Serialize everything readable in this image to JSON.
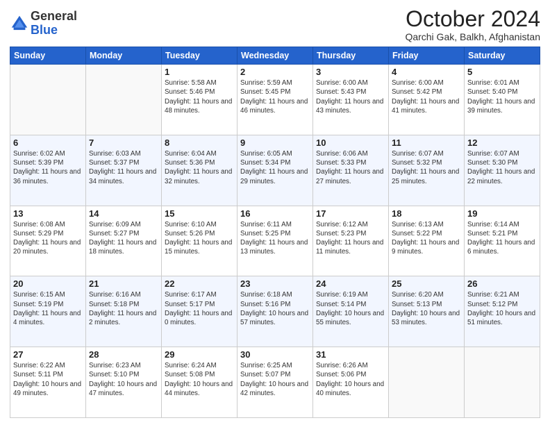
{
  "header": {
    "logo_line1": "General",
    "logo_line2": "Blue",
    "month": "October 2024",
    "location": "Qarchi Gak, Balkh, Afghanistan"
  },
  "weekdays": [
    "Sunday",
    "Monday",
    "Tuesday",
    "Wednesday",
    "Thursday",
    "Friday",
    "Saturday"
  ],
  "weeks": [
    [
      {
        "day": "",
        "detail": ""
      },
      {
        "day": "",
        "detail": ""
      },
      {
        "day": "1",
        "detail": "Sunrise: 5:58 AM\nSunset: 5:46 PM\nDaylight: 11 hours and 48 minutes."
      },
      {
        "day": "2",
        "detail": "Sunrise: 5:59 AM\nSunset: 5:45 PM\nDaylight: 11 hours and 46 minutes."
      },
      {
        "day": "3",
        "detail": "Sunrise: 6:00 AM\nSunset: 5:43 PM\nDaylight: 11 hours and 43 minutes."
      },
      {
        "day": "4",
        "detail": "Sunrise: 6:00 AM\nSunset: 5:42 PM\nDaylight: 11 hours and 41 minutes."
      },
      {
        "day": "5",
        "detail": "Sunrise: 6:01 AM\nSunset: 5:40 PM\nDaylight: 11 hours and 39 minutes."
      }
    ],
    [
      {
        "day": "6",
        "detail": "Sunrise: 6:02 AM\nSunset: 5:39 PM\nDaylight: 11 hours and 36 minutes."
      },
      {
        "day": "7",
        "detail": "Sunrise: 6:03 AM\nSunset: 5:37 PM\nDaylight: 11 hours and 34 minutes."
      },
      {
        "day": "8",
        "detail": "Sunrise: 6:04 AM\nSunset: 5:36 PM\nDaylight: 11 hours and 32 minutes."
      },
      {
        "day": "9",
        "detail": "Sunrise: 6:05 AM\nSunset: 5:34 PM\nDaylight: 11 hours and 29 minutes."
      },
      {
        "day": "10",
        "detail": "Sunrise: 6:06 AM\nSunset: 5:33 PM\nDaylight: 11 hours and 27 minutes."
      },
      {
        "day": "11",
        "detail": "Sunrise: 6:07 AM\nSunset: 5:32 PM\nDaylight: 11 hours and 25 minutes."
      },
      {
        "day": "12",
        "detail": "Sunrise: 6:07 AM\nSunset: 5:30 PM\nDaylight: 11 hours and 22 minutes."
      }
    ],
    [
      {
        "day": "13",
        "detail": "Sunrise: 6:08 AM\nSunset: 5:29 PM\nDaylight: 11 hours and 20 minutes."
      },
      {
        "day": "14",
        "detail": "Sunrise: 6:09 AM\nSunset: 5:27 PM\nDaylight: 11 hours and 18 minutes."
      },
      {
        "day": "15",
        "detail": "Sunrise: 6:10 AM\nSunset: 5:26 PM\nDaylight: 11 hours and 15 minutes."
      },
      {
        "day": "16",
        "detail": "Sunrise: 6:11 AM\nSunset: 5:25 PM\nDaylight: 11 hours and 13 minutes."
      },
      {
        "day": "17",
        "detail": "Sunrise: 6:12 AM\nSunset: 5:23 PM\nDaylight: 11 hours and 11 minutes."
      },
      {
        "day": "18",
        "detail": "Sunrise: 6:13 AM\nSunset: 5:22 PM\nDaylight: 11 hours and 9 minutes."
      },
      {
        "day": "19",
        "detail": "Sunrise: 6:14 AM\nSunset: 5:21 PM\nDaylight: 11 hours and 6 minutes."
      }
    ],
    [
      {
        "day": "20",
        "detail": "Sunrise: 6:15 AM\nSunset: 5:19 PM\nDaylight: 11 hours and 4 minutes."
      },
      {
        "day": "21",
        "detail": "Sunrise: 6:16 AM\nSunset: 5:18 PM\nDaylight: 11 hours and 2 minutes."
      },
      {
        "day": "22",
        "detail": "Sunrise: 6:17 AM\nSunset: 5:17 PM\nDaylight: 11 hours and 0 minutes."
      },
      {
        "day": "23",
        "detail": "Sunrise: 6:18 AM\nSunset: 5:16 PM\nDaylight: 10 hours and 57 minutes."
      },
      {
        "day": "24",
        "detail": "Sunrise: 6:19 AM\nSunset: 5:14 PM\nDaylight: 10 hours and 55 minutes."
      },
      {
        "day": "25",
        "detail": "Sunrise: 6:20 AM\nSunset: 5:13 PM\nDaylight: 10 hours and 53 minutes."
      },
      {
        "day": "26",
        "detail": "Sunrise: 6:21 AM\nSunset: 5:12 PM\nDaylight: 10 hours and 51 minutes."
      }
    ],
    [
      {
        "day": "27",
        "detail": "Sunrise: 6:22 AM\nSunset: 5:11 PM\nDaylight: 10 hours and 49 minutes."
      },
      {
        "day": "28",
        "detail": "Sunrise: 6:23 AM\nSunset: 5:10 PM\nDaylight: 10 hours and 47 minutes."
      },
      {
        "day": "29",
        "detail": "Sunrise: 6:24 AM\nSunset: 5:08 PM\nDaylight: 10 hours and 44 minutes."
      },
      {
        "day": "30",
        "detail": "Sunrise: 6:25 AM\nSunset: 5:07 PM\nDaylight: 10 hours and 42 minutes."
      },
      {
        "day": "31",
        "detail": "Sunrise: 6:26 AM\nSunset: 5:06 PM\nDaylight: 10 hours and 40 minutes."
      },
      {
        "day": "",
        "detail": ""
      },
      {
        "day": "",
        "detail": ""
      }
    ]
  ]
}
